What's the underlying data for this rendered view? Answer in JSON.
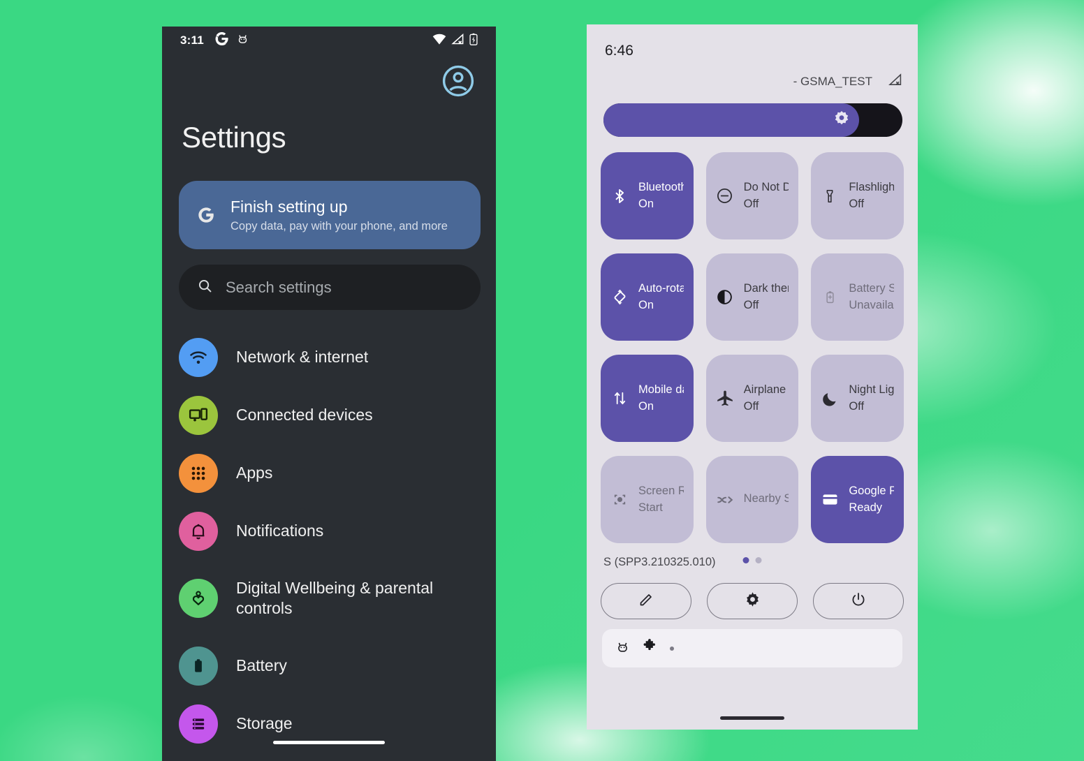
{
  "background": {
    "green": "#3ad883",
    "glow": "#ffffff"
  },
  "left_phone": {
    "status_bar": {
      "time": "3:11",
      "icons_left": [
        "google-g-icon",
        "android-head-icon"
      ],
      "icons_right": [
        "wifi-icon",
        "cellular-no-signal-icon",
        "battery-charging-icon"
      ]
    },
    "avatar_name": "account-avatar-icon",
    "title": "Settings",
    "finish_card": {
      "icon": "google-g-icon",
      "title": "Finish setting up",
      "subtitle": "Copy data, pay with your phone, and more",
      "color": "#4a6896"
    },
    "search": {
      "icon": "search-icon",
      "placeholder": "Search settings",
      "value": ""
    },
    "items": [
      {
        "label": "Network & internet",
        "icon": "wifi-icon",
        "color": "#539df3"
      },
      {
        "label": "Connected devices",
        "icon": "devices-icon",
        "color": "#9bc53d"
      },
      {
        "label": "Apps",
        "icon": "apps-grid-icon",
        "color": "#f3913c"
      },
      {
        "label": "Notifications",
        "icon": "bell-icon",
        "color": "#e0609e"
      },
      {
        "label": "Digital Wellbeing & parental controls",
        "icon": "heart-person-icon",
        "color": "#5fd071"
      },
      {
        "label": "Battery",
        "icon": "battery-icon",
        "color": "#4f9490"
      },
      {
        "label": "Storage",
        "icon": "storage-list-icon",
        "color": "#c457ec"
      }
    ]
  },
  "right_phone": {
    "status_bar": {
      "time": "6:46"
    },
    "carrier": {
      "text": "- GSMA_TEST",
      "icon": "cellular-no-signal-icon"
    },
    "brightness": {
      "icon": "brightness-icon",
      "percent": 85,
      "label": "Brightness"
    },
    "tiles": [
      {
        "label": "Bluetooth",
        "state": "On",
        "icon": "bluetooth-icon",
        "active": true,
        "disabled": false
      },
      {
        "label": "Do Not Disturb",
        "state": "Off",
        "icon": "do-not-disturb-icon",
        "active": false,
        "disabled": false
      },
      {
        "label": "Flashlight",
        "state": "Off",
        "icon": "flashlight-icon",
        "active": false,
        "disabled": false
      },
      {
        "label": "Auto-rotate",
        "state": "On",
        "icon": "auto-rotate-icon",
        "active": true,
        "disabled": false
      },
      {
        "label": "Dark theme",
        "state": "Off",
        "icon": "dark-theme-icon",
        "active": false,
        "disabled": false
      },
      {
        "label": "Battery Saver",
        "state": "Unavailable",
        "icon": "battery-saver-icon",
        "active": false,
        "disabled": true
      },
      {
        "label": "Mobile data",
        "state": "On",
        "icon": "mobile-data-icon",
        "active": true,
        "disabled": false
      },
      {
        "label": "Airplane mode",
        "state": "Off",
        "icon": "airplane-icon",
        "active": false,
        "disabled": false
      },
      {
        "label": "Night Light",
        "state": "Off",
        "icon": "moon-icon",
        "active": false,
        "disabled": false
      },
      {
        "label": "Screen Record",
        "state": "Start",
        "icon": "screen-record-icon",
        "active": false,
        "disabled": true
      },
      {
        "label": "Nearby Share",
        "state": "",
        "icon": "nearby-share-icon",
        "active": false,
        "disabled": true
      },
      {
        "label": "Google Pay",
        "state": "Ready",
        "icon": "credit-card-icon",
        "active": true,
        "disabled": false
      }
    ],
    "build": "S (SPP3.210325.010)",
    "pages": {
      "count": 2,
      "current": 1
    },
    "footer_buttons": [
      {
        "name": "edit-tiles-button",
        "icon": "pencil-icon"
      },
      {
        "name": "settings-button",
        "icon": "gear-icon"
      },
      {
        "name": "power-button",
        "icon": "power-icon"
      }
    ],
    "notification_shelf": {
      "icons": [
        "android-head-icon",
        "puzzle-piece-icon"
      ],
      "overflow": "more-dot"
    }
  },
  "colors": {
    "tile_active": "#5c52a9",
    "tile_inactive": "#c2bdd5",
    "panel_bg": "#e4e1e8",
    "dark_bg": "#2a2e33",
    "search_bg": "#1e2023"
  }
}
